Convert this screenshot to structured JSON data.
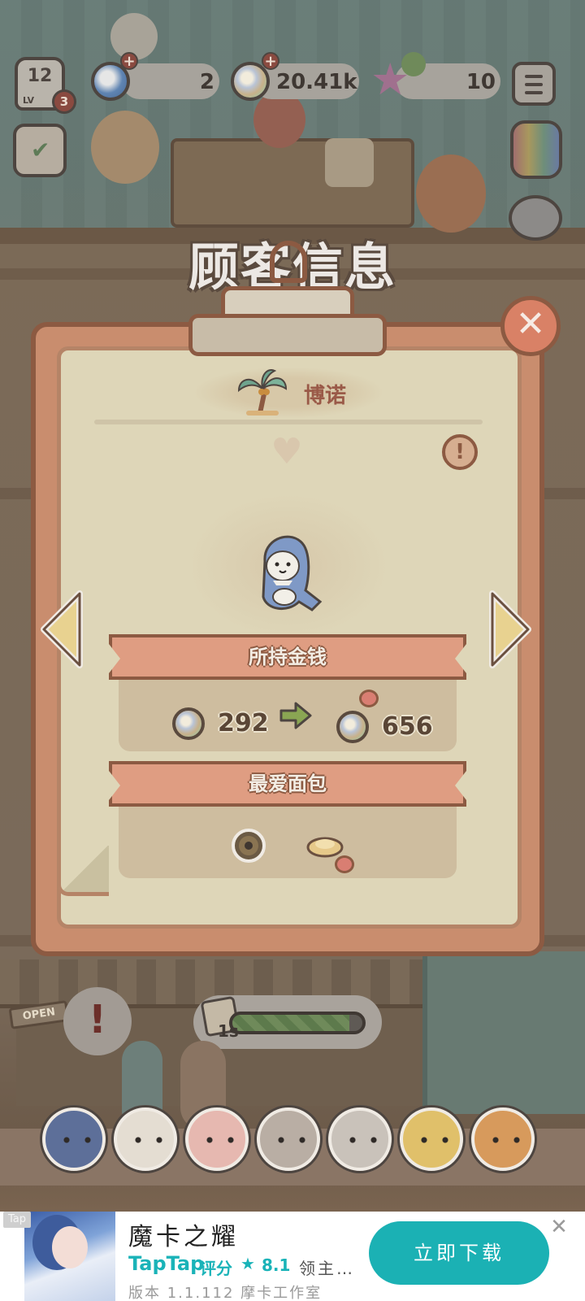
{
  "hud": {
    "level": "12",
    "level_label": "LV",
    "level_stars": "3",
    "currency_shells": "2",
    "currency_coins": "20.41k",
    "currency_stars": "10",
    "open_sign": "OPEN"
  },
  "dialog": {
    "title": "顾客信息",
    "customer_name": "博诺",
    "money_section": {
      "label": "所持金钱",
      "current": "292",
      "max": "656"
    },
    "bread_section": {
      "label": "最爱面包"
    }
  },
  "bottom_hud": {
    "timer": "1s",
    "progress": 0.9
  },
  "animal_bar": [
    "penguin",
    "sheep",
    "pig",
    "hamster",
    "tiger-cat",
    "giraffe",
    "orange-cat"
  ],
  "ad": {
    "tag": "Tap",
    "title": "魔卡之耀",
    "store": "TapTap",
    "rating_label": "评分",
    "rating_value": "8.1",
    "description": "领主…",
    "meta": "版本 1.1.112  摩卡工作室",
    "download": "立即下载",
    "close": "✕"
  },
  "colors": {
    "board": "#c98d6e",
    "paper": "#ded6b8",
    "banner": "#df9d82",
    "accent_teal": "#1bb1b4"
  }
}
